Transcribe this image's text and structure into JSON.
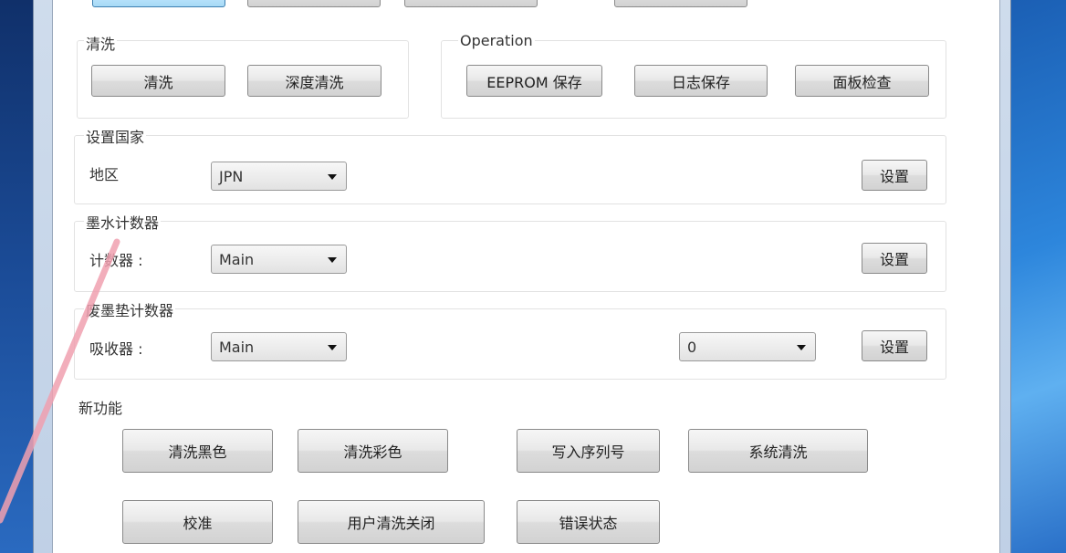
{
  "top_buttons": [
    "",
    "",
    "",
    ""
  ],
  "clean": {
    "title": "清洗",
    "btn_clean": "清洗",
    "btn_deep_clean": "深度清洗"
  },
  "operation": {
    "title": "Operation",
    "btn_eeprom": "EEPROM 保存",
    "btn_log": "日志保存",
    "btn_panel": "面板检查"
  },
  "country": {
    "title": "设置国家",
    "region_label": "地区",
    "region_value": "JPN",
    "set_button": "设置"
  },
  "ink_counter": {
    "title": "墨水计数器",
    "counter_label": "计数器 :",
    "counter_value": "Main",
    "set_button": "设置"
  },
  "waste_pad": {
    "title": "废墨垫计数器",
    "counter_label": "吸收器 :",
    "counter_value": "Main",
    "second_value": "0",
    "set_button": "设置"
  },
  "new_features": {
    "title": "新功能",
    "btn_clean_black": "清洗黑色",
    "btn_clean_color": "清洗彩色",
    "btn_write_serial": "写入序列号",
    "btn_system_clean": "系统清洗",
    "btn_calibrate": "校准",
    "btn_user_clean_off": "用户清洗关闭",
    "btn_error_status": "错误状态"
  }
}
